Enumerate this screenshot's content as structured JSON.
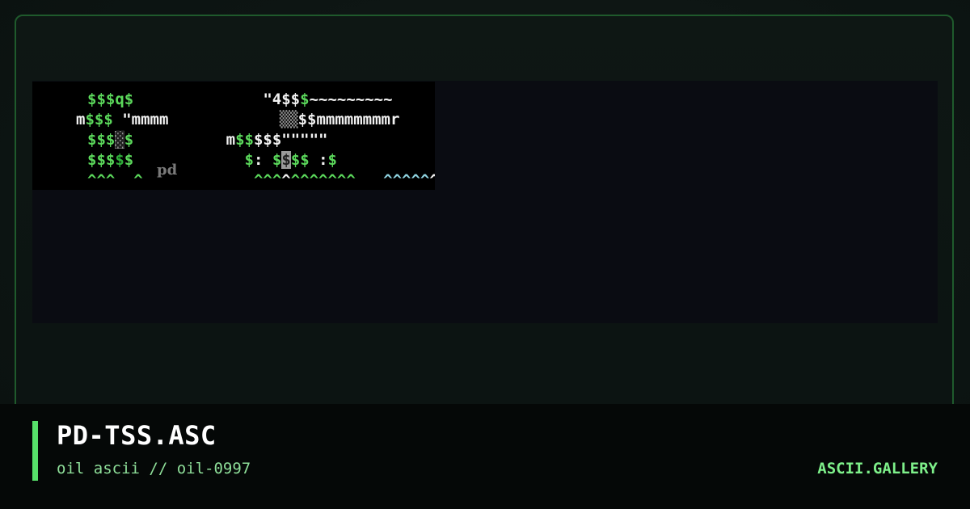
{
  "card": {
    "title": "PD-TSS.ASC",
    "subtitle": "oil ascii // oil-0997",
    "brand": "ASCII.GALLERY"
  },
  "art": {
    "tag": "pd",
    "lines": [
      "$$$q$              \"4$$$~~~~~~~~~",
      "m$$$ \"mmmm           ▒▒$$mmmmmmmmr",
      "$$$▓$          m$$$$$\"\"\"\"",
      "$$$$$           $: $$$$ :$",
      "^^^  ^           ^^^^^^^^^^   ^^^^^^"
    ]
  },
  "colors": {
    "accent": "#57e06a",
    "border": "#1f5a2c",
    "brand": "#7ef08a",
    "subtitle": "#8fe09a"
  }
}
